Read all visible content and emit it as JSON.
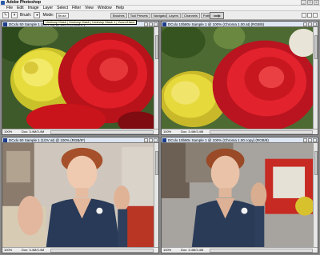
{
  "window": {
    "title": "Adobe Photoshop",
    "min_glyph": "_",
    "max_glyph": "□",
    "close_glyph": "×"
  },
  "menu": [
    "File",
    "Edit",
    "Image",
    "Layer",
    "Select",
    "Filter",
    "View",
    "Window",
    "Help"
  ],
  "options": {
    "brush_label": "Brush:",
    "mode_label": "Mode:",
    "mode_value": "Brush"
  },
  "palette_tabs_left": [
    "Brushes",
    "Tool Presets",
    "Navigator"
  ],
  "palette_tabs_right": [
    "Layers",
    "Channels",
    "Paths"
  ],
  "tooltip": "Unsharp Mask | Unsharp Mask | Unsharp Mask 1 | Zoom/Hand",
  "documents": [
    {
      "title": "DCxlo 50 Sample 1 (1/2V at) @ 100% (RGB/8*)",
      "zoom": "100%",
      "status": "Doc: 3.4M/3.4M",
      "image": "flowers-original"
    },
    {
      "title": "DCxlo 10b80x Sample 1 @ 100% (Chroma 1.00 at) (RGB/8)",
      "zoom": "100%",
      "status": "Doc: 3.4M/3.4M",
      "image": "flowers-processed"
    },
    {
      "title": "DCxlo 50 Sample 1 (1/2V at) @ 100% (RGB/8*)",
      "zoom": "100%",
      "status": "Doc: 3.4M/3.4M",
      "image": "figurine-original"
    },
    {
      "title": "DCxlo 10b80x Sample 1 @ 100% (Chroma 1.00 copy) (RGB/8)",
      "zoom": "100%",
      "status": "Doc: 3.4M/3.4M",
      "image": "figurine-processed"
    }
  ]
}
